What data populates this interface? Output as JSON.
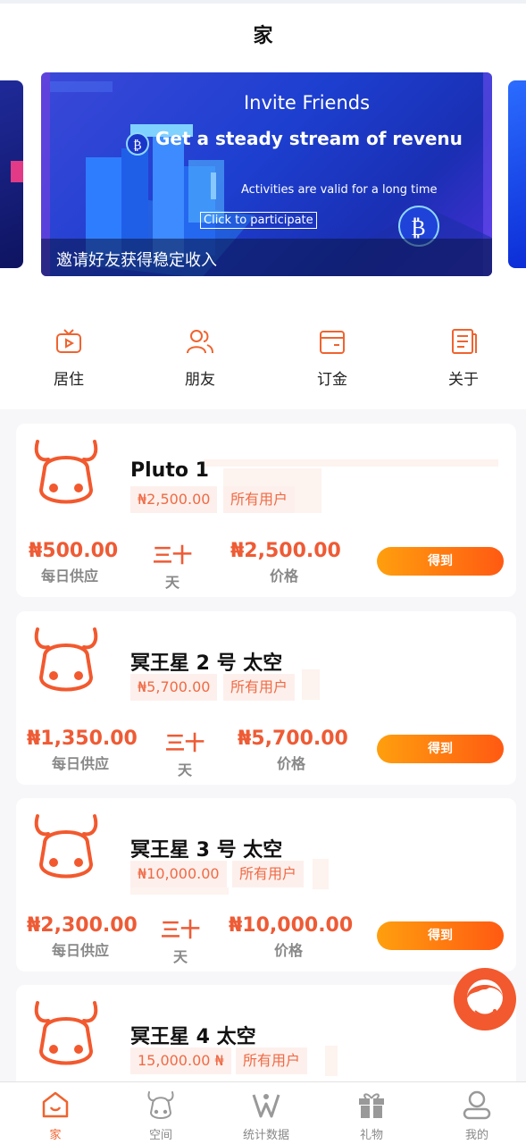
{
  "header": {
    "title": "家"
  },
  "banner": {
    "title": "Invite Friends",
    "headline": "Get a steady stream of revenu",
    "subtitle": "Activities are valid for a long time",
    "button": "Click to participate",
    "caption": "邀请好友获得稳定收入"
  },
  "menu": [
    {
      "label": "居住",
      "icon": "tv-icon"
    },
    {
      "label": "朋友",
      "icon": "friends-icon"
    },
    {
      "label": "订金",
      "icon": "wallet-icon"
    },
    {
      "label": "关于",
      "icon": "document-icon"
    }
  ],
  "products": [
    {
      "name": "Pluto 1",
      "price_tag": "₦2,500.00",
      "audience": "所有用户",
      "daily_value": "₦500.00",
      "daily_label": "每日供应",
      "days_value": "三十",
      "days_label": "天",
      "price_value": "₦2,500.00",
      "price_label": "价格",
      "button": "得到"
    },
    {
      "name": "冥王星 2 号 太空",
      "price_tag": "₦5,700.00",
      "audience": "所有用户",
      "daily_value": "₦1,350.00",
      "daily_label": "每日供应",
      "days_value": "三十",
      "days_label": "天",
      "price_value": "₦5,700.00",
      "price_label": "价格",
      "button": "得到"
    },
    {
      "name": "冥王星 3 号 太空",
      "price_tag": "₦10,000.00",
      "audience": "所有用户",
      "daily_value": "₦2,300.00",
      "daily_label": "每日供应",
      "days_value": "三十",
      "days_label": "天",
      "price_value": "₦10,000.00",
      "price_label": "价格",
      "button": "得到"
    },
    {
      "name": "冥王星 4 太空",
      "price_tag": "15,000.00 ₦",
      "audience": "所有用户"
    }
  ],
  "tabs": [
    {
      "label": "家",
      "icon": "home-icon",
      "active": true
    },
    {
      "label": "空间",
      "icon": "cow-icon"
    },
    {
      "label": "统计数据",
      "icon": "stats-icon"
    },
    {
      "label": "礼物",
      "icon": "gift-icon"
    },
    {
      "label": "我的",
      "icon": "user-icon"
    }
  ],
  "colors": {
    "accent": "#f0632f",
    "button_start": "#ff9f0e",
    "button_end": "#ff5a12",
    "text": "#222222",
    "muted": "#888888"
  }
}
